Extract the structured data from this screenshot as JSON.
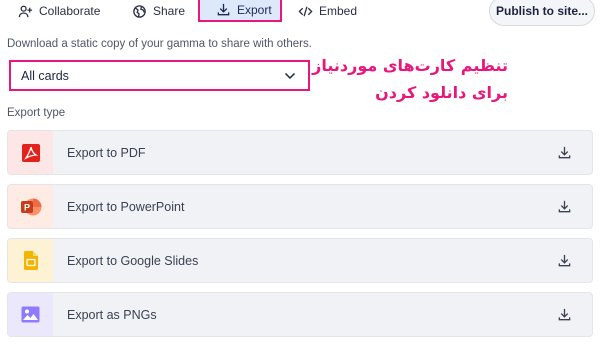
{
  "tabs": {
    "collaborate": "Collaborate",
    "share": "Share",
    "export": "Export",
    "embed": "Embed"
  },
  "publish_label": "Publish to site...",
  "description": "Download a static copy of your gamma to share with others.",
  "select": {
    "value": "All cards"
  },
  "annotation": {
    "line1": "تنظیم کارت‌های موردنیاز",
    "line2": "برای دانلود کردن"
  },
  "export_type_label": "Export type",
  "export_items": [
    {
      "label": "Export to PDF",
      "icon": "pdf-icon",
      "color": "#e3231b"
    },
    {
      "label": "Export to PowerPoint",
      "icon": "powerpoint-icon",
      "color": "#d24726"
    },
    {
      "label": "Export to Google Slides",
      "icon": "google-slides-icon",
      "color": "#f4b400"
    },
    {
      "label": "Export as PNGs",
      "icon": "image-icon",
      "color": "#7b61ff"
    }
  ],
  "colors": {
    "highlight": "#e8177c",
    "export_tab_bg": "#dde8fb"
  }
}
